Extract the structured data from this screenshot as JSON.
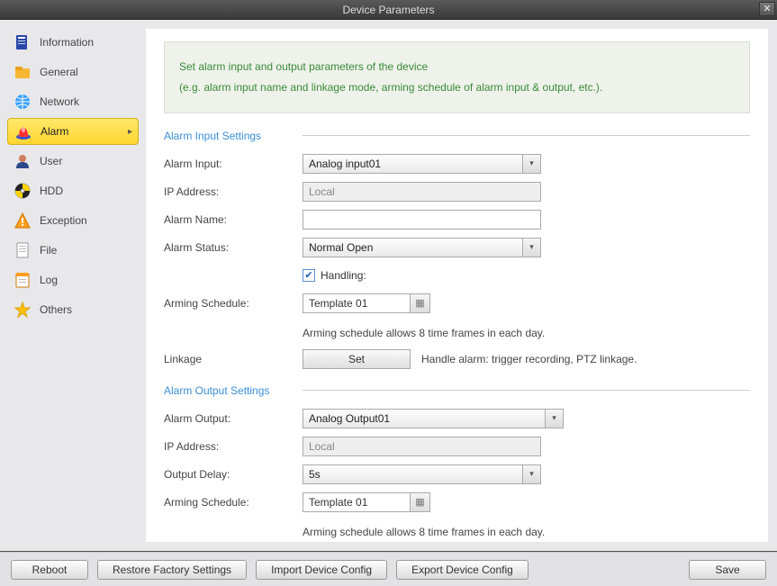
{
  "window": {
    "title": "Device Parameters"
  },
  "sidebar": {
    "items": [
      {
        "label": "Information"
      },
      {
        "label": "General"
      },
      {
        "label": "Network"
      },
      {
        "label": "Alarm"
      },
      {
        "label": "User"
      },
      {
        "label": "HDD"
      },
      {
        "label": "Exception"
      },
      {
        "label": "File"
      },
      {
        "label": "Log"
      },
      {
        "label": "Others"
      }
    ]
  },
  "info": {
    "line1": "Set alarm input and output parameters of the device",
    "line2": "(e.g. alarm input name and linkage mode, arming schedule of alarm input & output, etc.)."
  },
  "input_settings": {
    "title": "Alarm Input Settings",
    "alarm_input_label": "Alarm Input:",
    "alarm_input_value": "Analog input01",
    "ip_label": "IP Address:",
    "ip_value": "Local",
    "name_label": "Alarm Name:",
    "name_value": "",
    "status_label": "Alarm Status:",
    "status_value": "Normal Open",
    "handling_label": "Handling:",
    "handling_checked": true,
    "schedule_label": "Arming Schedule:",
    "schedule_value": "Template 01",
    "schedule_hint": "Arming schedule allows 8 time frames in each day.",
    "linkage_label": "Linkage",
    "linkage_button": "Set",
    "linkage_hint": "Handle alarm: trigger recording, PTZ linkage."
  },
  "output_settings": {
    "title": "Alarm Output Settings",
    "alarm_output_label": "Alarm Output:",
    "alarm_output_value": "Analog Output01",
    "ip_label": "IP Address:",
    "ip_value": "Local",
    "delay_label": "Output Delay:",
    "delay_value": "5s",
    "schedule_label": "Arming Schedule:",
    "schedule_value": "Template 01",
    "schedule_hint": "Arming schedule allows 8 time frames in each day."
  },
  "footer": {
    "reboot": "Reboot",
    "restore": "Restore Factory Settings",
    "import": "Import Device Config",
    "export": "Export Device Config",
    "save": "Save"
  }
}
